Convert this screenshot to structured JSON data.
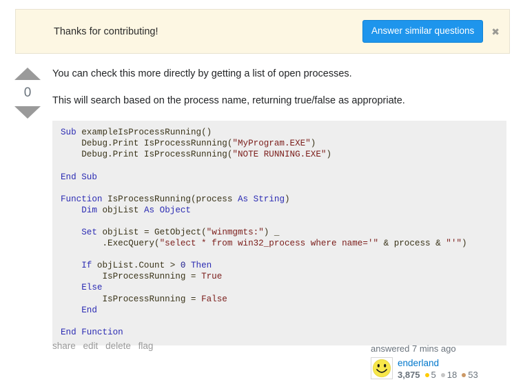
{
  "banner": {
    "message": "Thanks for contributing!",
    "action_label": "Answer similar questions",
    "close_label": "✖",
    "background_color": "#fdf7e3",
    "action_color": "#1e95ec"
  },
  "vote": {
    "up_icon": "triangle-up-icon",
    "down_icon": "triangle-down-icon",
    "count": "0"
  },
  "answer": {
    "paragraph_1": "You can check this more directly by getting a list of open processes.",
    "paragraph_2": "This will search based on the process name, returning true/false as appropriate.",
    "code_lines": [
      "Sub exampleIsProcessRunning()",
      "    Debug.Print IsProcessRunning(\"MyProgram.EXE\")",
      "    Debug.Print IsProcessRunning(\"NOTE RUNNING.EXE\")",
      "",
      "End Sub",
      "",
      "Function IsProcessRunning(process As String)",
      "    Dim objList As Object",
      "",
      "    Set objList = GetObject(\"winmgmts:\") _",
      "        .ExecQuery(\"select * from win32_process where name='\" & process & \"'\")",
      "",
      "    If objList.Count > 0 Then",
      "        IsProcessRunning = True",
      "    Else",
      "        IsProcessRunning = False",
      "    End",
      "",
      "End Function"
    ]
  },
  "post_actions": {
    "share": "share",
    "edit": "edit",
    "delete": "delete",
    "flag": "flag"
  },
  "user_card": {
    "answered_time": "answered 7 mins ago",
    "username": "enderland",
    "reputation": "3,875",
    "gold_badges": "5",
    "silver_badges": "18",
    "bronze_badges": "53",
    "avatar_icon": "smiley-face-avatar",
    "gold_color": "#ffcc01",
    "silver_color": "#c5c5c5",
    "bronze_color": "#cc9966"
  }
}
